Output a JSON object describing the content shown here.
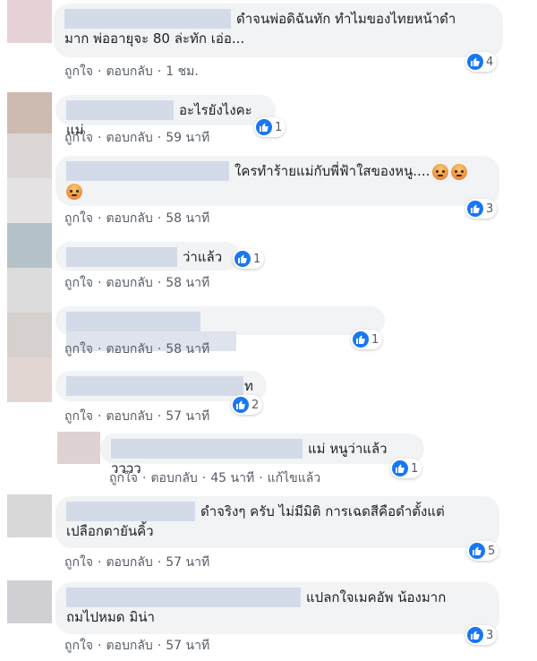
{
  "labels": {
    "like": "ถูกใจ",
    "reply": "ตอบกลับ",
    "edited": "แก้ไขแล้ว",
    "separator": "·"
  },
  "comments": [
    {
      "text1": "ดำจนพ่อดิฉันทัก ทำไมของไทยหน้าดำ",
      "text2": "มาก พ่ออายุจะ 80 ล่ะทัก เอ่อ...",
      "time": "1 ชม.",
      "reactions": "4"
    },
    {
      "text1": "อะไรยังไงคะแม่",
      "time": "59 นาที",
      "reactions": "1"
    },
    {
      "text1": "ใครทำร้ายแม่กับพี่ฟ้าใสของหนู....",
      "time": "58 นาที",
      "reactions": "3"
    },
    {
      "text1": "ว่าแล้ว",
      "time": "58 นาที",
      "reactions": "1"
    },
    {
      "time": "58 นาที",
      "reactions": "1"
    },
    {
      "text1": "ท",
      "time": "57 นาที",
      "reactions": "2"
    },
    {
      "text1": "แม่ หนูว่าแล้ววววว",
      "time": "45 นาที",
      "reactions": "1"
    },
    {
      "text1": "ดำจริงๆ ครับ ไม่มีมิติ การเฉดสีคือดำตั้งแต่",
      "text2": "เปลือกตายันคิ้ว",
      "time": "57 นาที",
      "reactions": "5"
    },
    {
      "text1": "แปลกใจเมคอัพ น้องมาก",
      "text2": "ถมไปหมด มิน่า",
      "time": "57 นาที",
      "reactions": "3"
    }
  ],
  "icons": {
    "like": "like-thumb-icon",
    "angry": "angry-face-icon"
  },
  "colors": {
    "like_blue": "#1877f2",
    "bubble_bg": "#f2f3f5",
    "meta_text": "#555c66"
  }
}
